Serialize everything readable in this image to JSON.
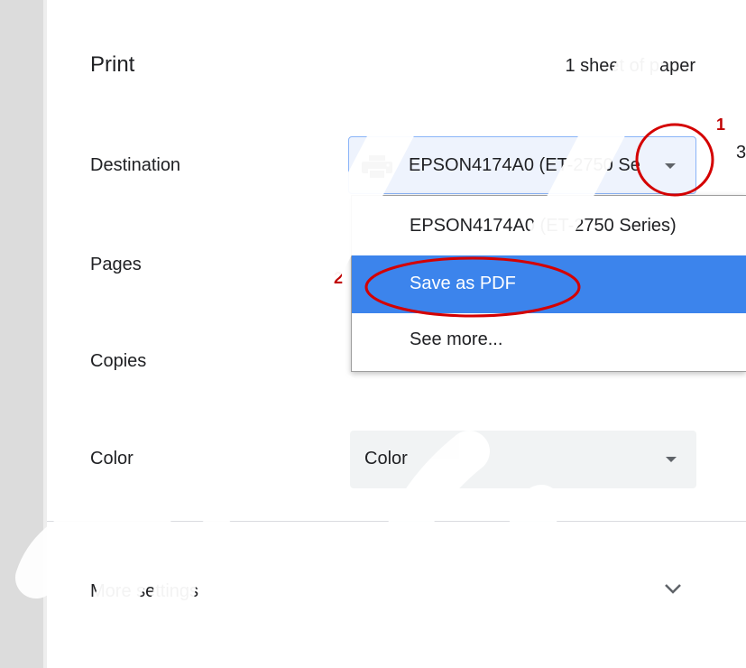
{
  "print": {
    "title": "Print",
    "sheet_count": "1 sheet of paper"
  },
  "destination": {
    "label": "Destination",
    "selected": "EPSON4174A0 (ET-2750 Series)",
    "icon": "printer-icon",
    "options": [
      {
        "label": "EPSON4174A0 (ET-2750 Series)",
        "highlighted": false
      },
      {
        "label": "Save as PDF",
        "highlighted": true
      },
      {
        "label": "See more..."
      }
    ]
  },
  "pages": {
    "label": "Pages"
  },
  "copies": {
    "label": "Copies"
  },
  "color": {
    "label": "Color",
    "selected": "Color"
  },
  "more_settings": {
    "label": "More settings",
    "icon": "chevron-down-icon"
  },
  "annotations": {
    "step1": "1",
    "step2": "2",
    "color": "#d40000"
  },
  "edge_char": "3",
  "colors": {
    "highlight": "#3c84ec",
    "select_border": "#8ab4f8",
    "select_bg": "#eef3fd",
    "field_bg": "#f1f3f4"
  }
}
